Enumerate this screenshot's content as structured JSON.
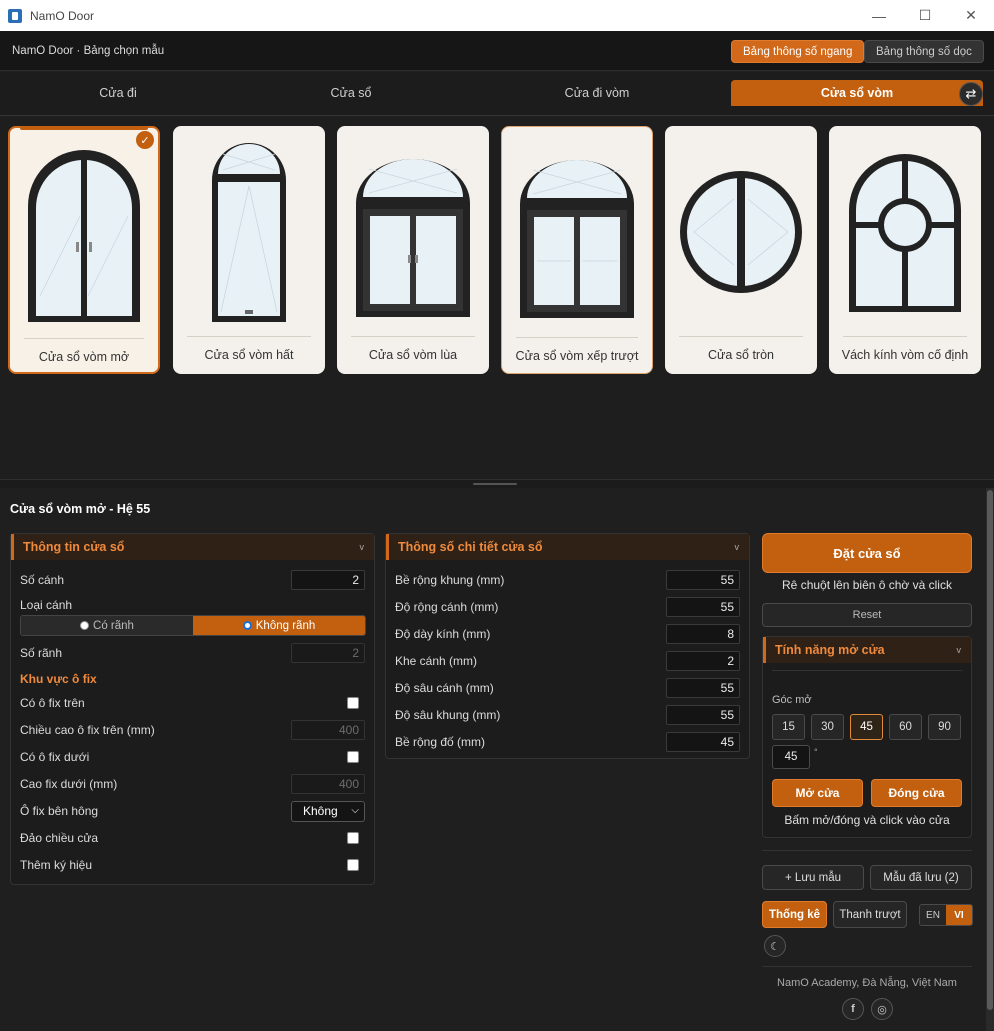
{
  "window": {
    "title": "NamO Door",
    "minimize": "—",
    "maximize": "☐",
    "close": "✕"
  },
  "header": {
    "breadcrumb": "NamO Door · Bảng chọn mẫu",
    "spec_horizontal": "Bảng thông số ngang",
    "spec_vertical": "Bảng thông số dọc"
  },
  "tabs": [
    {
      "label": "Cửa đi"
    },
    {
      "label": "Cửa sổ"
    },
    {
      "label": "Cửa đi vòm"
    },
    {
      "label": "Cửa sổ vòm",
      "active": true
    }
  ],
  "swap_icon": "⇄",
  "cards": [
    {
      "label": "Cửa sổ vòm mở",
      "selected": true,
      "icon": "arched-casement-window-icon"
    },
    {
      "label": "Cửa sổ vòm hất",
      "icon": "arched-awning-window-icon"
    },
    {
      "label": "Cửa sổ vòm lùa",
      "icon": "arched-sliding-window-icon"
    },
    {
      "label": "Cửa sổ vòm xếp trượt",
      "icon": "arched-folding-window-icon"
    },
    {
      "label": "Cửa sổ tròn",
      "icon": "round-window-icon"
    },
    {
      "label": "Vách kính vòm cố định",
      "icon": "fixed-arched-glass-icon"
    }
  ],
  "check_mark": "✓",
  "product_title": "Cửa sổ vòm mở - Hệ 55",
  "info_panel": {
    "title": "Thông tin cửa sổ",
    "so_canh_label": "Số cánh",
    "so_canh_value": "2",
    "loai_canh_label": "Loại cánh",
    "loai_canh_options": [
      "Có rãnh",
      "Không rãnh"
    ],
    "so_ranh_label": "Số rãnh",
    "so_ranh_value": "2",
    "fix_section": "Khu vực ô fix",
    "co_fix_tren": "Có ô fix trên",
    "chieu_cao_fix_tren": "Chiều cao ô fix trên (mm)",
    "chieu_cao_fix_tren_value": "400",
    "co_fix_duoi": "Có ô fix dưới",
    "cao_fix_duoi": "Cao fix dưới (mm)",
    "cao_fix_duoi_value": "400",
    "fix_ben_hong": "Ô fix bên hông",
    "fix_ben_hong_value": "Không",
    "dao_chieu": "Đảo chiều cửa",
    "them_ky_hieu": "Thêm ký hiệu"
  },
  "detail_panel": {
    "title": "Thông số chi tiết cửa sổ",
    "rows": [
      {
        "label": "Bề rộng khung (mm)",
        "value": "55"
      },
      {
        "label": "Độ rộng cánh (mm)",
        "value": "55"
      },
      {
        "label": "Độ dày kính (mm)",
        "value": "8"
      },
      {
        "label": "Khe cánh (mm)",
        "value": "2"
      },
      {
        "label": "Độ sâu cánh (mm)",
        "value": "55"
      },
      {
        "label": "Độ sâu khung (mm)",
        "value": "55"
      },
      {
        "label": "Bề rộng đố (mm)",
        "value": "45"
      }
    ]
  },
  "actions": {
    "place_button": "Đặt cửa sổ",
    "place_hint": "Rê chuột lên biên ô chờ và click",
    "reset": "Reset"
  },
  "open_panel": {
    "title": "Tính năng mở cửa",
    "angle_label": "Góc mở",
    "angles": [
      "15",
      "30",
      "45",
      "60",
      "90"
    ],
    "angle_value": "45",
    "degree": "°",
    "open_button": "Mở cửa",
    "close_button": "Đóng cửa",
    "hint": "Bấm mở/đóng và click vào cửa"
  },
  "bottom": {
    "save_template": "+ Lưu mẫu",
    "saved_templates": "Mẫu đã lưu (2)",
    "stats": "Thống kê",
    "slider": "Thanh trượt",
    "lang_en": "EN",
    "lang_vi": "VI",
    "theme_icon": "☾",
    "footer": "NamO Academy, Đà Nẵng, Việt Nam",
    "facebook_icon": "f",
    "web_icon": "◎"
  },
  "colors": {
    "accent": "#c2600f",
    "accent_text": "#f08a3c",
    "background": "#1f1f1f",
    "card": "#f4f1ec",
    "frame": "#222222",
    "glass": "#e8f1f6"
  }
}
